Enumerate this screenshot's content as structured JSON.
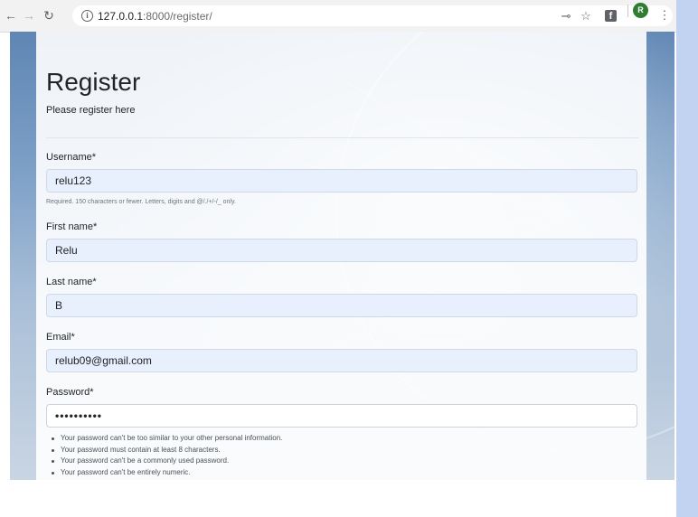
{
  "browser": {
    "url_host": "127.0.0.1",
    "url_rest": ":8000/register/",
    "avatar_letter": "R",
    "icons": {
      "back": "arrow-left-icon",
      "forward": "arrow-right-icon",
      "reload": "reload-icon",
      "info": "info-icon",
      "key": "key-icon",
      "bookmark": "star-icon",
      "extension": "facebook-icon",
      "menu": "kebab-menu-icon"
    }
  },
  "page": {
    "title": "Register",
    "subtitle": "Please register here"
  },
  "form": {
    "username": {
      "label": "Username*",
      "value": "relu123",
      "help": "Required. 150 characters or fewer. Letters, digits and @/./+/-/_ only."
    },
    "first_name": {
      "label": "First name*",
      "value": "Relu"
    },
    "last_name": {
      "label": "Last name*",
      "value": "B"
    },
    "email": {
      "label": "Email*",
      "value": "relub09@gmail.com"
    },
    "password": {
      "label": "Password*",
      "value": "••••••••••",
      "help": [
        "Your password can't be too similar to your other personal information.",
        "Your password must contain at least 8 characters.",
        "Your password can't be a commonly used password.",
        "Your password can't be entirely numeric."
      ]
    }
  },
  "colors": {
    "input_autofill_bg": "#e8f0fe",
    "text_primary": "#212529",
    "text_muted": "#6c757d",
    "avatar_bg": "#2e7d32",
    "side_panel": "#c2d3f2"
  }
}
